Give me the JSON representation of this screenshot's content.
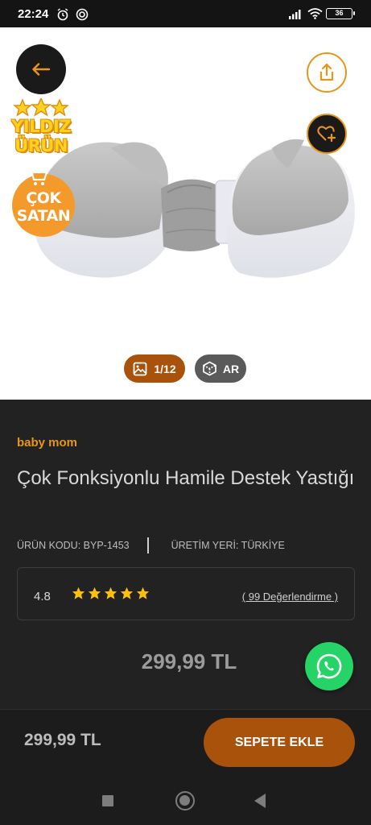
{
  "status_bar": {
    "time": "22:24",
    "battery": "36"
  },
  "gallery": {
    "badge_star_line1": "YILDIZ",
    "badge_star_line2": "ÜRÜN",
    "badge_bestseller_line1": "ÇOK",
    "badge_bestseller_line2": "SATAN",
    "image_counter": "1/12",
    "ar_label": "AR"
  },
  "product": {
    "brand": "baby mom",
    "title": "Çok Fonksiyonlu Hamile Destek Yastığı",
    "code": "ÜRÜN KODU: BYP-1453",
    "origin": "ÜRETİM YERİ: TÜRKİYE",
    "rating": "4.8",
    "rating_stars": 5,
    "reviews": "( 99 Değerlendirme )",
    "price": "299,99 TL"
  },
  "bottom_bar": {
    "price": "299,99 TL",
    "add_to_cart": "SEPETE EKLE"
  },
  "icons": {
    "back": "back-arrow-icon",
    "share": "share-icon",
    "favorite": "heart-plus-icon",
    "gallery": "image-icon",
    "ar": "cube-icon",
    "whatsapp": "whatsapp-icon"
  },
  "colors": {
    "accent": "#e8951a",
    "button": "#a8520c",
    "background": "#222222",
    "whatsapp": "#25d366"
  }
}
